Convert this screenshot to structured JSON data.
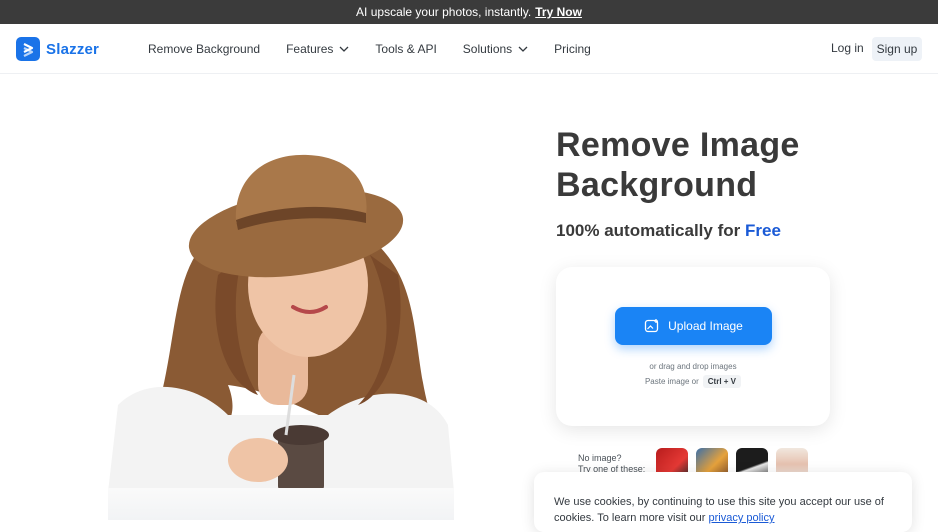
{
  "announcement": {
    "text": "AI upscale your photos, instantly.",
    "cta": "Try Now"
  },
  "nav": {
    "brand": "Slazzer",
    "items": [
      {
        "label": "Remove Background",
        "dropdown": false
      },
      {
        "label": "Features",
        "dropdown": true
      },
      {
        "label": "Tools & API",
        "dropdown": false
      },
      {
        "label": "Solutions",
        "dropdown": true
      },
      {
        "label": "Pricing",
        "dropdown": false
      }
    ],
    "login": "Log in",
    "signup": "Sign up"
  },
  "hero": {
    "title_line1": "Remove Image",
    "title_line2": "Background",
    "subtitle_prefix": "100% automatically for",
    "subtitle_highlight": "Free"
  },
  "upload": {
    "button_label": "Upload Image",
    "drag_text": "or drag and drop images",
    "paste_text": "Paste image or",
    "shortcut": "Ctrl + V"
  },
  "samples": {
    "line1": "No image?",
    "line2": "Try one of these:"
  },
  "cookie": {
    "text": "We use cookies, by continuing to use this site you accept our use of cookies.  To learn more visit our",
    "link": "privacy policy"
  },
  "colors": {
    "brand": "#1a73e8",
    "primary_button": "#1a84f5",
    "free_text": "#1a5ad6"
  }
}
